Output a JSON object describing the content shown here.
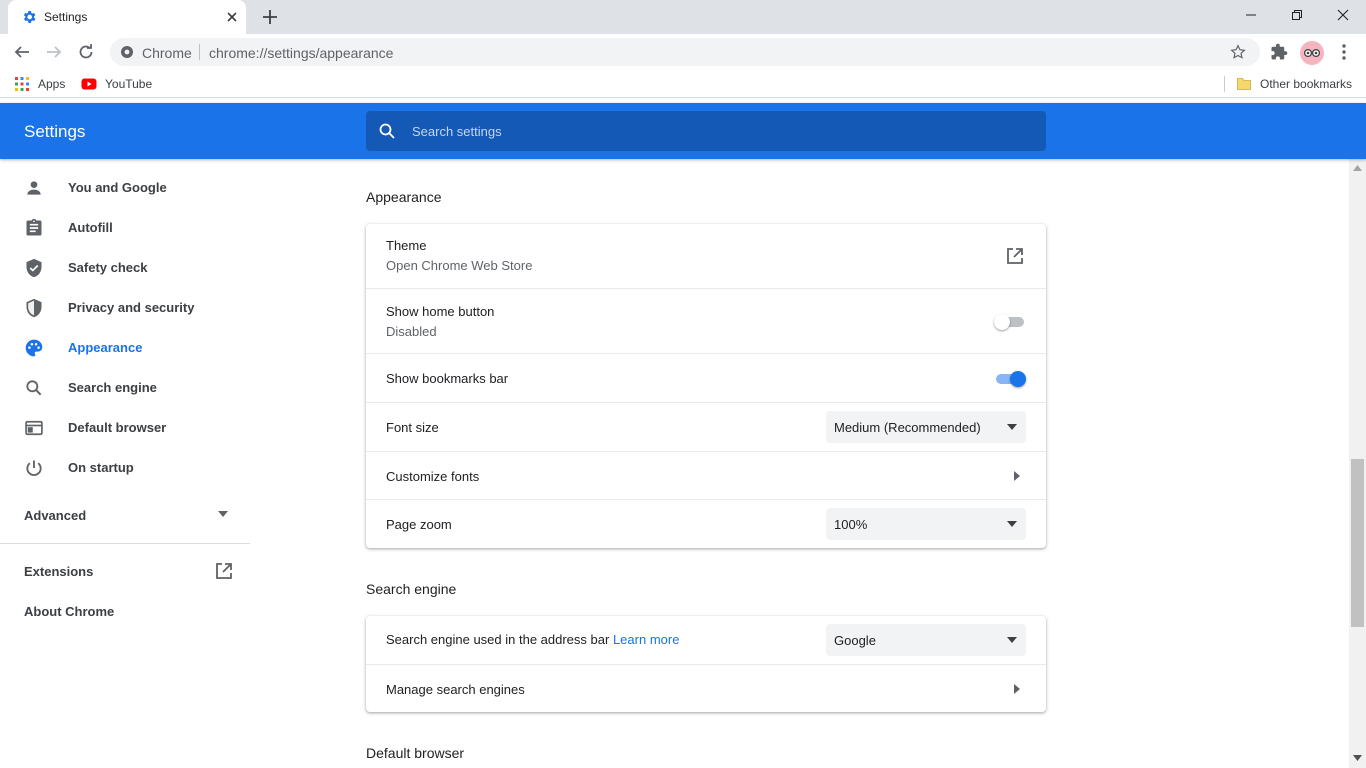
{
  "browser": {
    "tab_title": "Settings",
    "omnibox_site": "Chrome",
    "omnibox_url": "chrome://settings/appearance",
    "bookmarks": [
      {
        "label": "Apps"
      },
      {
        "label": "YouTube"
      }
    ],
    "other_bookmarks": "Other bookmarks"
  },
  "header": {
    "title": "Settings",
    "search_placeholder": "Search settings"
  },
  "sidebar": {
    "items": [
      {
        "label": "You and Google",
        "icon": "person-icon"
      },
      {
        "label": "Autofill",
        "icon": "clipboard-icon"
      },
      {
        "label": "Safety check",
        "icon": "shield-check-icon"
      },
      {
        "label": "Privacy and security",
        "icon": "shield-icon"
      },
      {
        "label": "Appearance",
        "icon": "palette-icon",
        "active": true
      },
      {
        "label": "Search engine",
        "icon": "search-icon"
      },
      {
        "label": "Default browser",
        "icon": "browser-window-icon"
      },
      {
        "label": "On startup",
        "icon": "power-icon"
      }
    ],
    "advanced": "Advanced",
    "extensions": "Extensions",
    "about": "About Chrome"
  },
  "appearance": {
    "title": "Appearance",
    "theme": {
      "label": "Theme",
      "sub": "Open Chrome Web Store"
    },
    "home_button": {
      "label": "Show home button",
      "sub": "Disabled",
      "enabled": false
    },
    "bookmarks_bar": {
      "label": "Show bookmarks bar",
      "enabled": true
    },
    "font_size": {
      "label": "Font size",
      "value": "Medium (Recommended)"
    },
    "customize_fonts": {
      "label": "Customize fonts"
    },
    "page_zoom": {
      "label": "Page zoom",
      "value": "100%"
    }
  },
  "search_engine": {
    "title": "Search engine",
    "used_label": "Search engine used in the address bar",
    "learn_more": "Learn more",
    "value": "Google",
    "manage": "Manage search engines"
  },
  "default_browser": {
    "title": "Default browser"
  },
  "colors": {
    "accent": "#1a73e8",
    "header_bg": "#1a73e8"
  }
}
